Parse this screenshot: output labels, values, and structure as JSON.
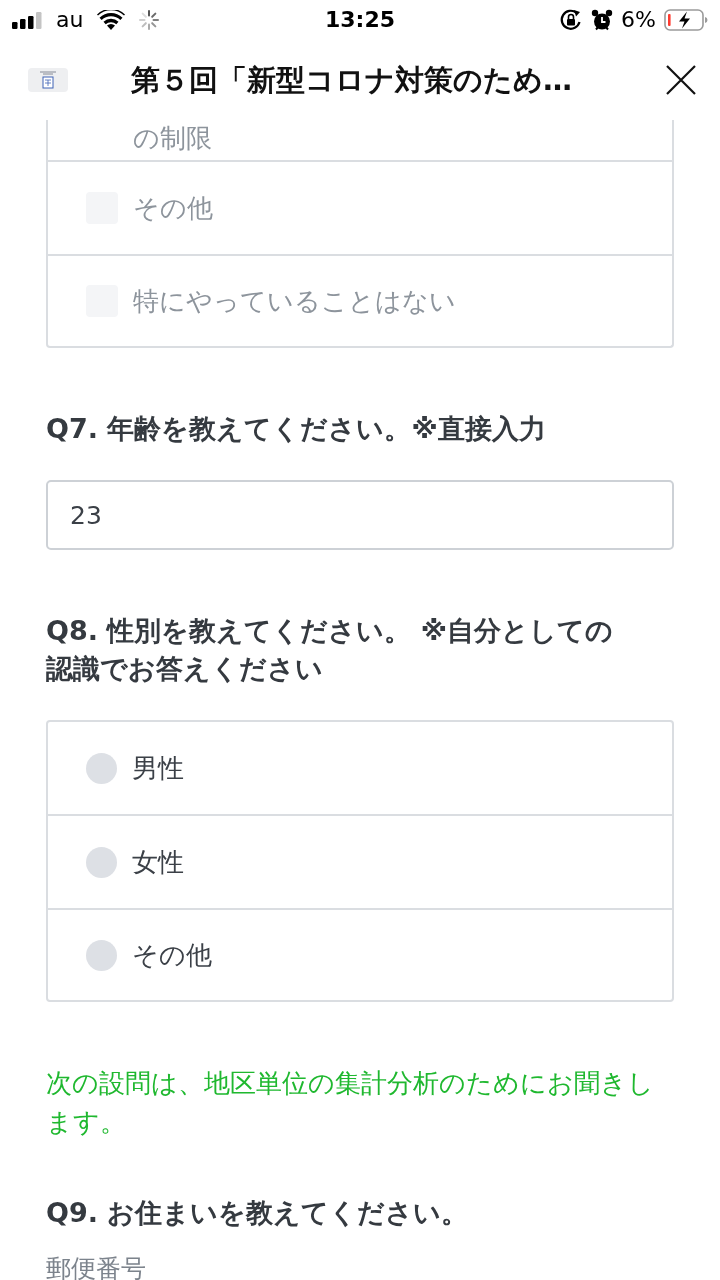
{
  "status_bar": {
    "carrier": "au",
    "time": "13:25",
    "battery_percent": "6%"
  },
  "header": {
    "title": "第５回「新型コロナ対策のため…"
  },
  "form": {
    "blocks": [
      {
        "kind": "checkbox_group",
        "options": [
          {
            "kind": "continued",
            "label": "の制限",
            "disabled": true
          },
          {
            "kind": "option",
            "label": "その他",
            "checked": false,
            "disabled": true
          },
          {
            "kind": "option",
            "label": "特にやっていることはない",
            "checked": false,
            "disabled": true
          }
        ]
      },
      {
        "kind": "question",
        "text": "Q7. 年齢を教えてください。※直接入力"
      },
      {
        "kind": "text_field",
        "value": "23"
      },
      {
        "kind": "question",
        "text": "Q8. 性別を教えてください。 ※自分としての認識でお答えください"
      },
      {
        "kind": "radio_group",
        "options": [
          {
            "label": "男性",
            "selected": false
          },
          {
            "label": "女性",
            "selected": false
          },
          {
            "label": "その他",
            "selected": false
          }
        ]
      },
      {
        "kind": "note",
        "text": "次の設問は、地区単位の集計分析のためにお聞きします。"
      },
      {
        "kind": "question",
        "text": "Q9. お住まいを教えてください。"
      },
      {
        "kind": "field_label",
        "text": "郵便番号"
      }
    ]
  }
}
